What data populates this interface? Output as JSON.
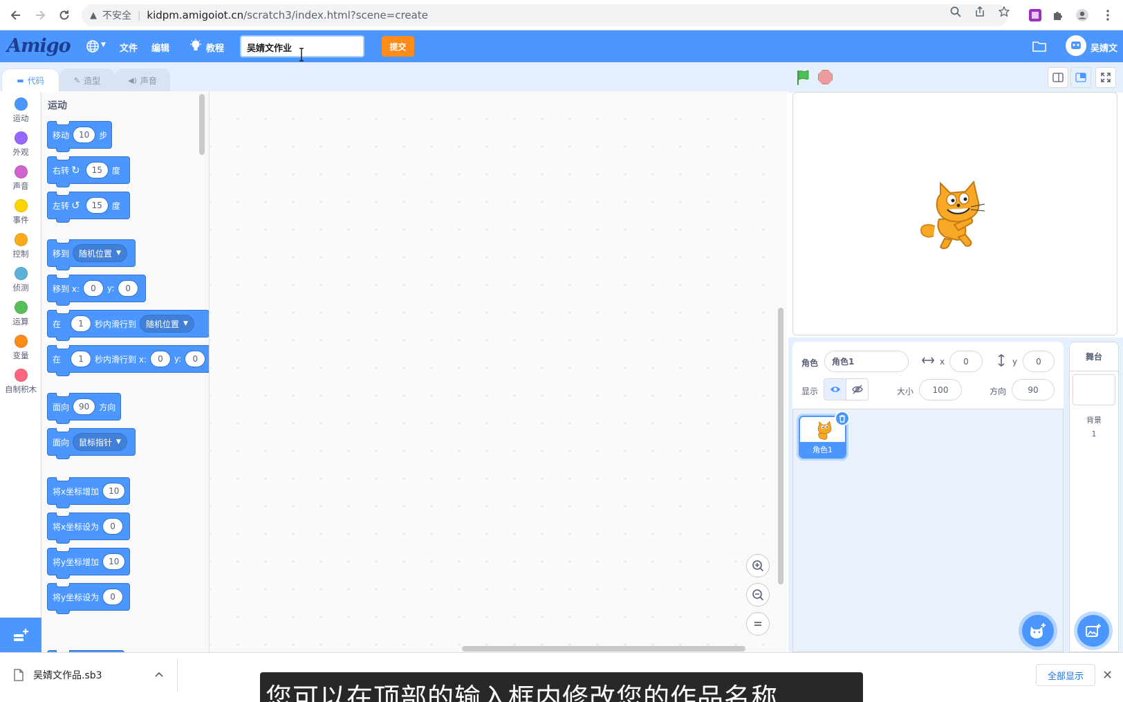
{
  "browser": {
    "insecure_label": "不安全",
    "url_host": "kidpm.amigoiot.cn",
    "url_path": "/scratch3/index.html?scene=create"
  },
  "menubar": {
    "logo": "Amigo",
    "file": "文件",
    "edit": "编辑",
    "tutorial": "教程",
    "project_title": "吴婧文作业",
    "submit": "提交",
    "username": "吴婧文"
  },
  "tabs": {
    "code": "代码",
    "costumes": "造型",
    "sounds": "声音"
  },
  "categories": [
    {
      "label": "运动",
      "color": "#4c97ff"
    },
    {
      "label": "外观",
      "color": "#9966ff"
    },
    {
      "label": "声音",
      "color": "#cf63cf"
    },
    {
      "label": "事件",
      "color": "#ffd500"
    },
    {
      "label": "控制",
      "color": "#ffab19"
    },
    {
      "label": "侦测",
      "color": "#5cb1d6"
    },
    {
      "label": "运算",
      "color": "#59c059"
    },
    {
      "label": "变量",
      "color": "#ff8c1a"
    },
    {
      "label": "自制积木",
      "color": "#ff6680"
    }
  ],
  "palette": {
    "heading": "运动",
    "move_steps": {
      "a": "移动",
      "v": "10",
      "b": "步"
    },
    "turn_right": {
      "a": "右转",
      "v": "15",
      "b": "度"
    },
    "turn_left": {
      "a": "左转",
      "v": "15",
      "b": "度"
    },
    "goto": {
      "a": "移到",
      "menu": "随机位置"
    },
    "goto_xy": {
      "a": "移到 x:",
      "x": "0",
      "b": "y:",
      "y": "0"
    },
    "glide_to": {
      "a": "在",
      "v": "1",
      "b": "秒内滑行到",
      "menu": "随机位置"
    },
    "glide_xy": {
      "a": "在",
      "v": "1",
      "b": "秒内滑行到 x:",
      "x": "0",
      "c": "y:",
      "y": "0"
    },
    "point_dir": {
      "a": "面向",
      "v": "90",
      "b": "方向"
    },
    "point_towards": {
      "a": "面向",
      "menu": "鼠标指针"
    },
    "change_x": {
      "a": "将x坐标增加",
      "v": "10"
    },
    "set_x": {
      "a": "将x坐标设为",
      "v": "0"
    },
    "change_y": {
      "a": "将y坐标增加",
      "v": "10"
    },
    "set_y": {
      "a": "将y坐标设为",
      "v": "0"
    }
  },
  "sprite_info": {
    "sprite_label": "角色",
    "sprite_name": "角色1",
    "x_label": "x",
    "x": "0",
    "y_label": "y",
    "y": "0",
    "show_label": "显示",
    "size_label": "大小",
    "size": "100",
    "direction_label": "方向",
    "direction": "90"
  },
  "sprites": [
    {
      "name": "角色1"
    }
  ],
  "stage_selector": {
    "title": "舞台",
    "backdrops_label": "背景",
    "backdrops_count": "1"
  },
  "download": {
    "filename": "吴婧文作品.sb3",
    "show_all": "全部显示"
  },
  "subtitle": "您可以在顶部的输入框内修改您的作品名称"
}
